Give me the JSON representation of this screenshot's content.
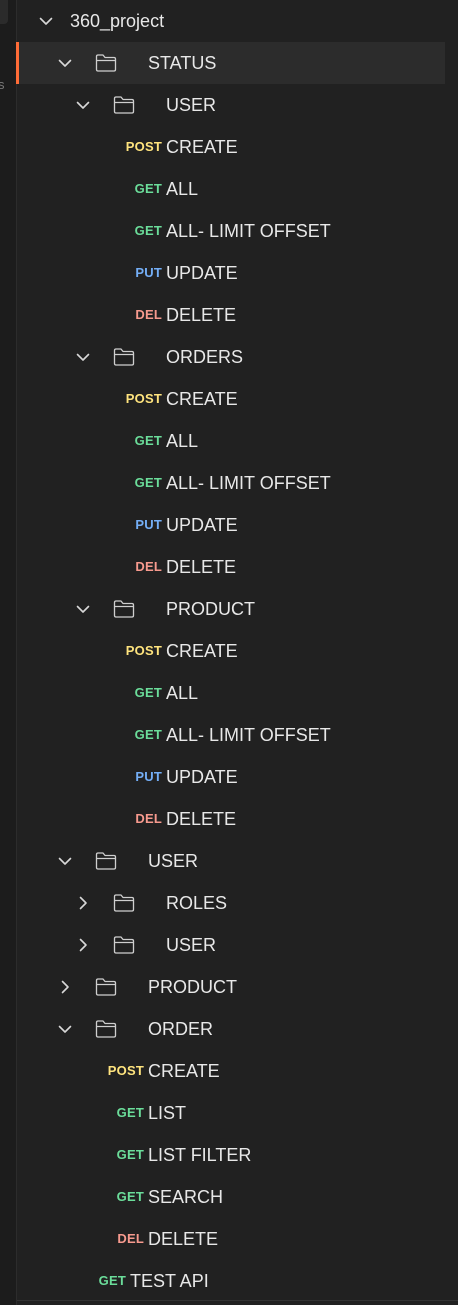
{
  "sidebar": {
    "partial_label": "s",
    "collection": {
      "name": "360_project",
      "expanded": true,
      "items": [
        {
          "type": "folder",
          "name": "STATUS",
          "expanded": true,
          "selected": true,
          "depth": 1,
          "items": [
            {
              "type": "folder",
              "name": "USER",
              "expanded": true,
              "depth": 2,
              "items": [
                {
                  "type": "request",
                  "method": "POST",
                  "name": "CREATE"
                },
                {
                  "type": "request",
                  "method": "GET",
                  "name": "ALL"
                },
                {
                  "type": "request",
                  "method": "GET",
                  "name": "ALL- LIMIT OFFSET"
                },
                {
                  "type": "request",
                  "method": "PUT",
                  "name": "UPDATE"
                },
                {
                  "type": "request",
                  "method": "DEL",
                  "name": "DELETE"
                }
              ]
            },
            {
              "type": "folder",
              "name": "ORDERS",
              "expanded": true,
              "depth": 2,
              "items": [
                {
                  "type": "request",
                  "method": "POST",
                  "name": "CREATE"
                },
                {
                  "type": "request",
                  "method": "GET",
                  "name": "ALL"
                },
                {
                  "type": "request",
                  "method": "GET",
                  "name": "ALL- LIMIT OFFSET"
                },
                {
                  "type": "request",
                  "method": "PUT",
                  "name": "UPDATE"
                },
                {
                  "type": "request",
                  "method": "DEL",
                  "name": "DELETE"
                }
              ]
            },
            {
              "type": "folder",
              "name": "PRODUCT",
              "expanded": true,
              "depth": 2,
              "items": [
                {
                  "type": "request",
                  "method": "POST",
                  "name": "CREATE"
                },
                {
                  "type": "request",
                  "method": "GET",
                  "name": "ALL"
                },
                {
                  "type": "request",
                  "method": "GET",
                  "name": "ALL- LIMIT OFFSET"
                },
                {
                  "type": "request",
                  "method": "PUT",
                  "name": "UPDATE"
                },
                {
                  "type": "request",
                  "method": "DEL",
                  "name": "DELETE"
                }
              ]
            }
          ]
        },
        {
          "type": "folder",
          "name": "USER",
          "expanded": true,
          "depth": 1,
          "items": [
            {
              "type": "folder",
              "name": "ROLES",
              "expanded": false,
              "depth": 2
            },
            {
              "type": "folder",
              "name": "USER",
              "expanded": false,
              "depth": 2
            }
          ]
        },
        {
          "type": "folder",
          "name": "PRODUCT",
          "expanded": false,
          "depth": 1
        },
        {
          "type": "folder",
          "name": "ORDER",
          "expanded": true,
          "depth": 1,
          "items": [
            {
              "type": "request",
              "method": "POST",
              "name": "CREATE"
            },
            {
              "type": "request",
              "method": "GET",
              "name": "LIST"
            },
            {
              "type": "request",
              "method": "GET",
              "name": "LIST FILTER"
            },
            {
              "type": "request",
              "method": "GET",
              "name": "SEARCH"
            },
            {
              "type": "request",
              "method": "DEL",
              "name": "DELETE"
            }
          ]
        },
        {
          "type": "request",
          "method": "GET",
          "name": "TEST API"
        }
      ]
    }
  },
  "colors": {
    "GET": "#6bdd9a",
    "POST": "#ffe47e",
    "PUT": "#74aef6",
    "DEL": "#f79a8e",
    "accent": "#ff6c37"
  },
  "icons": {
    "expanded": "chevron-down-icon",
    "collapsed": "chevron-right-icon",
    "folder": "folder-icon"
  }
}
